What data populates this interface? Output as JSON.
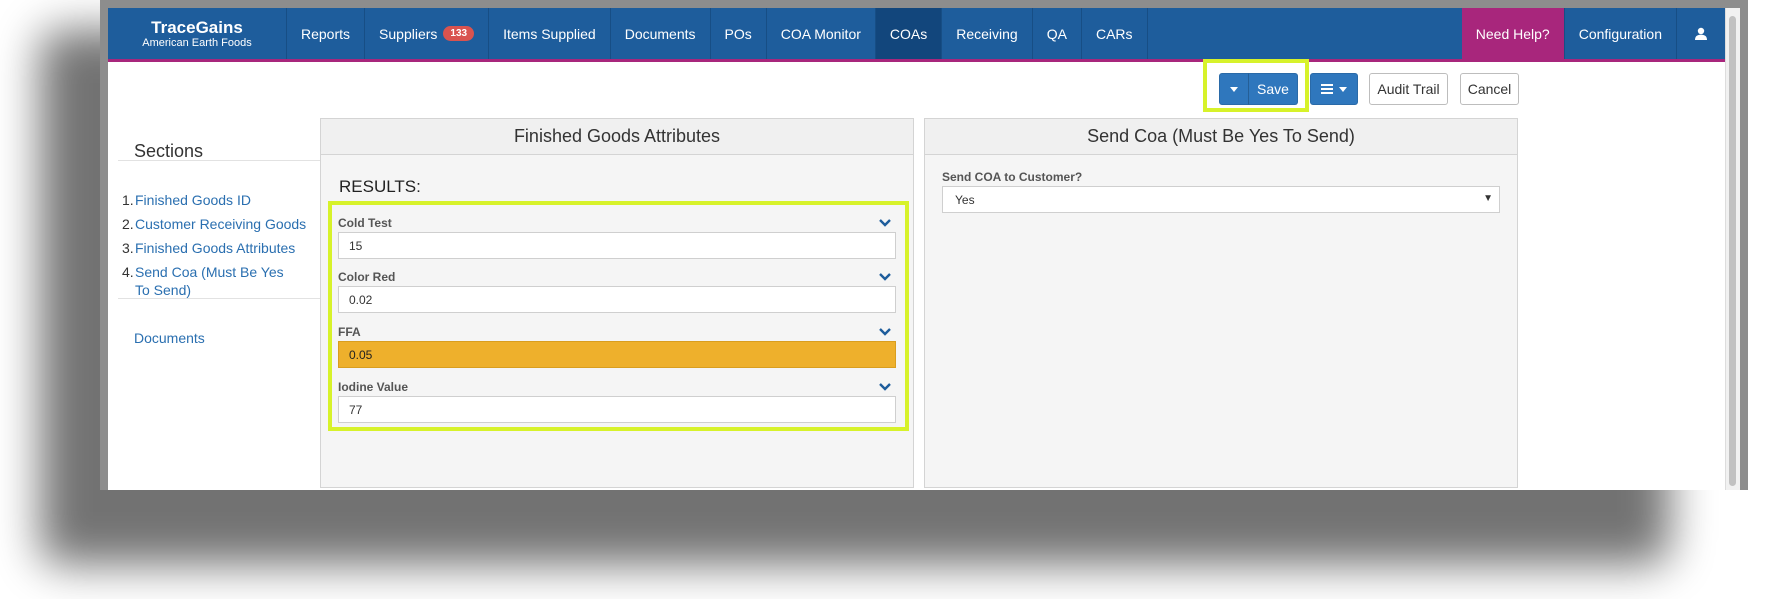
{
  "header": {
    "brand_name": "TraceGains",
    "brand_sub": "American Earth Foods",
    "nav": [
      {
        "label": "Reports"
      },
      {
        "label": "Suppliers",
        "badge": "133"
      },
      {
        "label": "Items Supplied"
      },
      {
        "label": "Documents"
      },
      {
        "label": "POs"
      },
      {
        "label": "COA Monitor"
      },
      {
        "label": "COAs"
      },
      {
        "label": "Receiving"
      },
      {
        "label": "QA"
      },
      {
        "label": "CARs"
      }
    ],
    "help": "Need Help?",
    "config": "Configuration",
    "user_icon": "user-icon"
  },
  "toolbar": {
    "save": "Save",
    "menu_icon": "hamburger-icon",
    "audit": "Audit Trail",
    "cancel": "Cancel"
  },
  "sidebar": {
    "title": "Sections",
    "items": [
      {
        "num": "1.",
        "label": "Finished Goods ID"
      },
      {
        "num": "2.",
        "label": "Customer Receiving Goods"
      },
      {
        "num": "3.",
        "label": "Finished Goods Attributes"
      },
      {
        "num": "4.",
        "label": "Send Coa (Must Be Yes To Send)"
      }
    ],
    "documents": "Documents"
  },
  "attributes_panel": {
    "title": "Finished Goods Attributes",
    "results_label": "RESULTS:",
    "fields": [
      {
        "label": "Cold Test",
        "value": "15",
        "status": "normal"
      },
      {
        "label": "Color Red",
        "value": "0.02",
        "status": "normal"
      },
      {
        "label": "FFA",
        "value": "0.05",
        "status": "warning"
      },
      {
        "label": "Iodine Value",
        "value": "77",
        "status": "normal"
      }
    ]
  },
  "send_panel": {
    "title": "Send Coa (Must Be Yes To Send)",
    "question": "Send COA to Customer?",
    "selected": "Yes"
  },
  "colors": {
    "nav_bg": "#1e5d9c",
    "accent_magenta": "#a8267c",
    "primary_button": "#2f77bd",
    "warning_fill": "#eeb02c",
    "highlight": "#d7f22a"
  }
}
